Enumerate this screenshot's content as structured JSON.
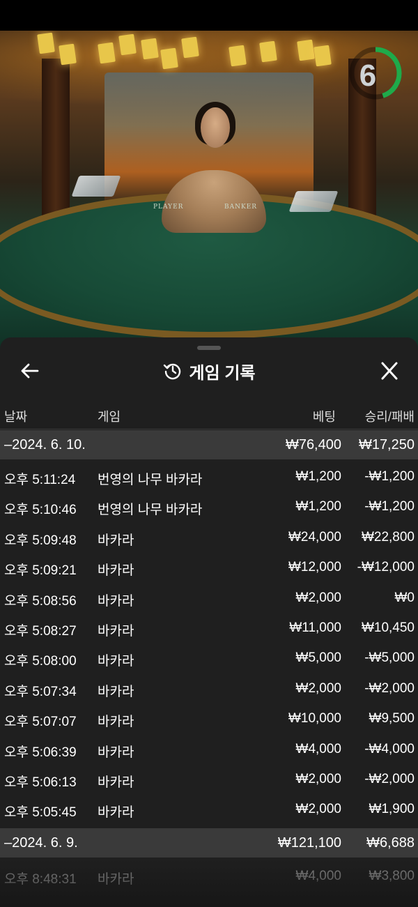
{
  "timer": {
    "value": "6",
    "remaining_fraction": 0.45,
    "color": "#1faa4a"
  },
  "table": {
    "player_label": "PLAYER",
    "banker_label": "BANKER"
  },
  "history": {
    "title": "게임 기록",
    "columns": {
      "date": "날짜",
      "game": "게임",
      "bet": "베팅",
      "result": "승리/패배"
    },
    "groups": [
      {
        "date": "–2024. 6. 10.",
        "total_bet": "₩76,400",
        "total_result": "₩17,250",
        "rows": [
          {
            "time": "오후 5:11:24",
            "game": "번영의 나무 바카라",
            "bet": "₩1,200",
            "result": "-₩1,200"
          },
          {
            "time": "오후 5:10:46",
            "game": "번영의 나무 바카라",
            "bet": "₩1,200",
            "result": "-₩1,200"
          },
          {
            "time": "오후 5:09:48",
            "game": "바카라",
            "bet": "₩24,000",
            "result": "₩22,800"
          },
          {
            "time": "오후 5:09:21",
            "game": "바카라",
            "bet": "₩12,000",
            "result": "-₩12,000"
          },
          {
            "time": "오후 5:08:56",
            "game": "바카라",
            "bet": "₩2,000",
            "result": "₩0"
          },
          {
            "time": "오후 5:08:27",
            "game": "바카라",
            "bet": "₩11,000",
            "result": "₩10,450"
          },
          {
            "time": "오후 5:08:00",
            "game": "바카라",
            "bet": "₩5,000",
            "result": "-₩5,000"
          },
          {
            "time": "오후 5:07:34",
            "game": "바카라",
            "bet": "₩2,000",
            "result": "-₩2,000"
          },
          {
            "time": "오후 5:07:07",
            "game": "바카라",
            "bet": "₩10,000",
            "result": "₩9,500"
          },
          {
            "time": "오후 5:06:39",
            "game": "바카라",
            "bet": "₩4,000",
            "result": "-₩4,000"
          },
          {
            "time": "오후 5:06:13",
            "game": "바카라",
            "bet": "₩2,000",
            "result": "-₩2,000"
          },
          {
            "time": "오후 5:05:45",
            "game": "바카라",
            "bet": "₩2,000",
            "result": "₩1,900"
          }
        ]
      },
      {
        "date": "–2024. 6. 9.",
        "total_bet": "₩121,100",
        "total_result": "₩6,688",
        "rows": [
          {
            "time": "오후 8:48:31",
            "game": "바카라",
            "bet": "₩4,000",
            "result": "₩3,800"
          }
        ]
      }
    ]
  }
}
